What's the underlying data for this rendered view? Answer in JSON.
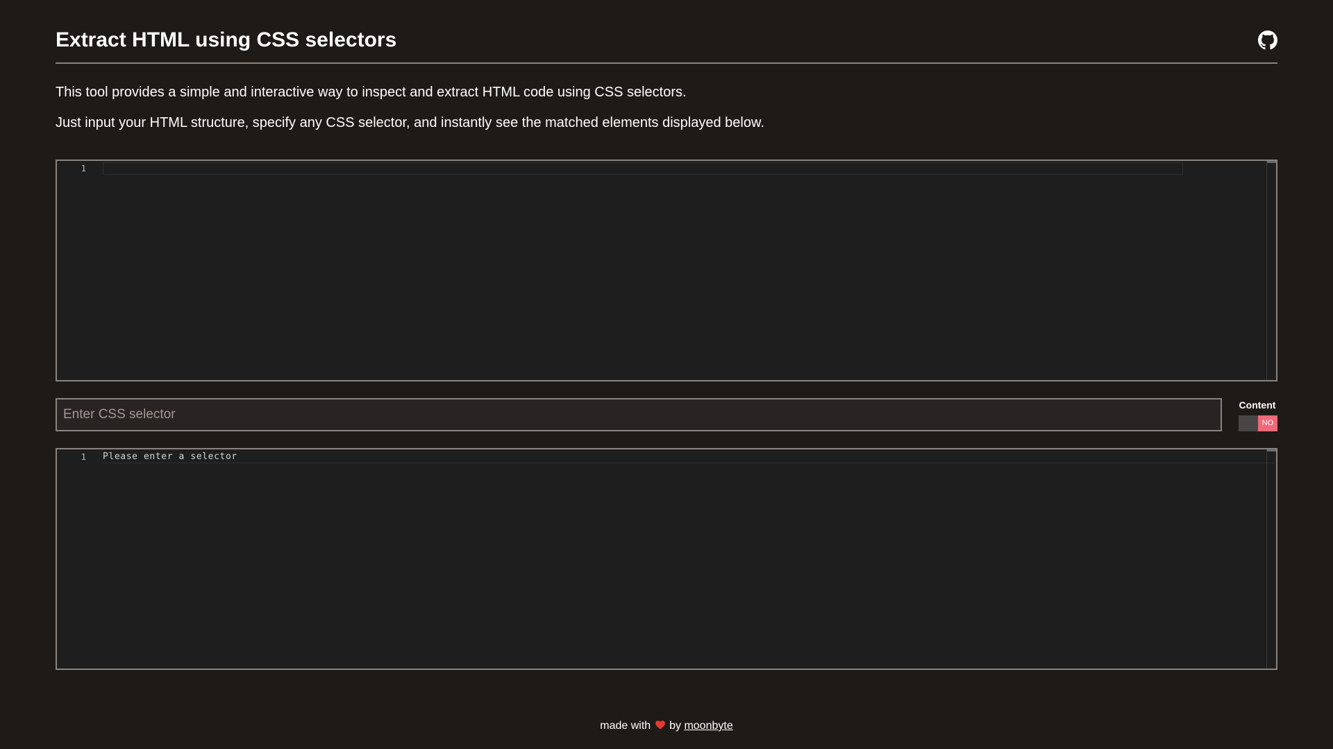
{
  "header": {
    "title": "Extract HTML using CSS selectors",
    "github_icon": "github-icon"
  },
  "intro": {
    "paragraph_1": "This tool provides a simple and interactive way to inspect and extract HTML code using CSS selectors.",
    "paragraph_2": "Just input your HTML structure, specify any CSS selector, and instantly see the matched elements displayed below."
  },
  "html_editor": {
    "line_number": "1",
    "content": ""
  },
  "selector": {
    "value": "",
    "placeholder": "Enter CSS selector"
  },
  "content_toggle": {
    "label": "Content",
    "state": "NO",
    "on": false
  },
  "output_editor": {
    "line_number": "1",
    "content": "Please enter a selector"
  },
  "footer": {
    "prefix": "made with",
    "heart_icon": "heart-icon",
    "by": "by",
    "author": "moonbyte"
  },
  "colors": {
    "background": "#1e1a17",
    "editor_background": "#1e1e1e",
    "border": "#8a8480",
    "toggle_off": "#f0687a",
    "heart": "#e53935"
  }
}
